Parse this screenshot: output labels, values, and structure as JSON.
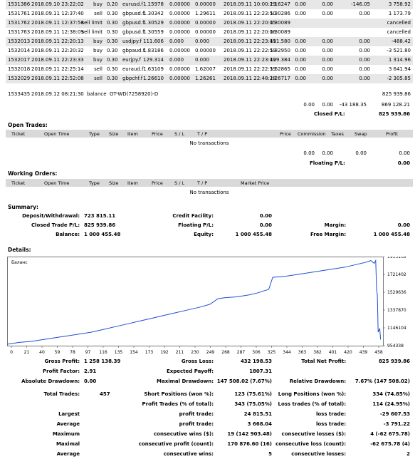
{
  "closed_trades": [
    {
      "ticket": "1531386",
      "open_time": "2018.09.10 23:22:02",
      "type": "buy",
      "size": "0.20",
      "item": "eurusd.f",
      "price": "1.15978",
      "sl": "0.00000",
      "tp": "0.00000",
      "close_time": "2018.09.11 10:00:29",
      "close_price": "1.16247",
      "commission": "0.00",
      "taxes": "0.00",
      "swap": "-146.05",
      "profit": "3 758.92"
    },
    {
      "ticket": "1531761",
      "open_time": "2018.09.11 12:37:40",
      "type": "sell",
      "size": "0.30",
      "item": "gbpusd.f",
      "price": "1.30342",
      "sl": "0.00000",
      "tp": "1.29611",
      "close_time": "2018.09.11 22:23:50",
      "close_price": "1.30286",
      "commission": "0.00",
      "taxes": "0.00",
      "swap": "0.00",
      "profit": "1 173.79"
    },
    {
      "ticket": "1531762",
      "open_time": "2018.09.11 12:37:56",
      "type": "sell limit",
      "size": "0.30",
      "item": "gbpusd.f",
      "price": "1.30529",
      "sl": "0.00000",
      "tp": "0.00000",
      "close_time": "2018.09.11 22:20:05",
      "close_price": "1.30089",
      "commission": "",
      "taxes": "",
      "swap": "",
      "profit": "cancelled"
    },
    {
      "ticket": "1531763",
      "open_time": "2018.09.11 12:38:09",
      "type": "sell limit",
      "size": "0.30",
      "item": "gbpusd.f",
      "price": "1.30559",
      "sl": "0.00000",
      "tp": "0.00000",
      "close_time": "2018.09.11 22:20:06",
      "close_price": "1.30089",
      "commission": "",
      "taxes": "",
      "swap": "",
      "profit": "cancelled"
    },
    {
      "ticket": "1532013",
      "open_time": "2018.09.11 22:20:13",
      "type": "buy",
      "size": "0.30",
      "item": "usdjpy.f",
      "price": "111.606",
      "sl": "0.000",
      "tp": "0.000",
      "close_time": "2018.09.11 22:23:49",
      "close_price": "111.580",
      "commission": "0.00",
      "taxes": "0.00",
      "swap": "0.00",
      "profit": "-488.42"
    },
    {
      "ticket": "1532014",
      "open_time": "2018.09.11 22:20:32",
      "type": "buy",
      "size": "0.30",
      "item": "gbpaud.f",
      "price": "1.83186",
      "sl": "0.00000",
      "tp": "0.00000",
      "close_time": "2018.09.11 22:22:59",
      "close_price": "1.82950",
      "commission": "0.00",
      "taxes": "0.00",
      "swap": "0.00",
      "profit": "-3 521.80"
    },
    {
      "ticket": "1532017",
      "open_time": "2018.09.11 22:23:33",
      "type": "buy",
      "size": "0.30",
      "item": "eurjpy.f",
      "price": "129.314",
      "sl": "0.000",
      "tp": "0.000",
      "close_time": "2018.09.11 22:23:49",
      "close_price": "129.384",
      "commission": "0.00",
      "taxes": "0.00",
      "swap": "0.00",
      "profit": "1 314.96"
    },
    {
      "ticket": "1532018",
      "open_time": "2018.09.11 22:25:14",
      "type": "sell",
      "size": "0.30",
      "item": "euraud.f",
      "price": "1.63109",
      "sl": "0.00000",
      "tp": "1.62007",
      "close_time": "2018.09.11 22:22:59",
      "close_price": "1.62865",
      "commission": "0.00",
      "taxes": "0.00",
      "swap": "0.00",
      "profit": "3 641.94"
    },
    {
      "ticket": "1532029",
      "open_time": "2018.09.11 22:52:08",
      "type": "sell",
      "size": "0.30",
      "item": "gbpchf.f",
      "price": "1.26610",
      "sl": "0.00000",
      "tp": "1.26261",
      "close_time": "2018.09.11 22:48:28",
      "close_price": "1.26717",
      "commission": "0.00",
      "taxes": "0.00",
      "swap": "0.00",
      "profit": "-2 305.85"
    }
  ],
  "balance_row": {
    "ticket": "1533435",
    "time": "2018.09.12 08:21:30",
    "type": "balance",
    "comment": "OT-WD(7258920)-D",
    "profit": "825 939.86"
  },
  "closed_totals": {
    "commission": "0.00",
    "taxes": "0.00",
    "swap": "-43 188.35",
    "profit": "869 128.21"
  },
  "closed_pl": {
    "label": "Closed P/L:",
    "value": "825 939.86"
  },
  "open_trades": {
    "title": "Open Trades:",
    "headers": [
      "Ticket",
      "Open Time",
      "Type",
      "Size",
      "Item",
      "Price",
      "S / L",
      "T / P",
      "Price",
      "Commission",
      "Taxes",
      "Swap",
      "Profit"
    ],
    "empty": "No transactions",
    "totals": {
      "commission": "0.00",
      "taxes": "0.00",
      "swap": "0.00",
      "profit": "0.00"
    },
    "floating_label": "Floating P/L:",
    "floating_value": "0.00"
  },
  "working_orders": {
    "title": "Working Orders:",
    "headers": [
      "Ticket",
      "Open Time",
      "Type",
      "Size",
      "Item",
      "Price",
      "S / L",
      "T / P",
      "Market Price"
    ],
    "empty": "No transactions"
  },
  "summary": {
    "title": "Summary:",
    "deposit_label": "Deposit/Withdrawal:",
    "deposit_value": "723 815.11",
    "credit_label": "Credit Facility:",
    "credit_value": "0.00",
    "closed_label": "Closed Trade P/L:",
    "closed_value": "825 939.86",
    "floating_label": "Floating P/L:",
    "floating_value": "0.00",
    "margin_label": "Margin:",
    "margin_value": "0.00",
    "balance_label": "Balance:",
    "balance_value": "1 000 455.48",
    "equity_label": "Equity:",
    "equity_value": "1 000 455.48",
    "free_margin_label": "Free Margin:",
    "free_margin_value": "1 000 455.48"
  },
  "details_title": "Details:",
  "chart_data": {
    "type": "line",
    "legend": "Баланс",
    "x_ticks": [
      "0",
      "21",
      "40",
      "59",
      "78",
      "97",
      "116",
      "135",
      "154",
      "173",
      "192",
      "211",
      "230",
      "249",
      "268",
      "287",
      "306",
      "325",
      "344",
      "363",
      "382",
      "401",
      "420",
      "439",
      "458"
    ],
    "y_ticks": [
      "1913169",
      "1721402",
      "1529636",
      "1337870",
      "1146104",
      "954338"
    ],
    "ylim": [
      954338,
      1913169
    ],
    "xlim": [
      0,
      467
    ],
    "series": [
      {
        "name": "Баланс",
        "points": [
          [
            0,
            970000
          ],
          [
            15,
            990000
          ],
          [
            30,
            1000000
          ],
          [
            45,
            1020000
          ],
          [
            60,
            1040000
          ],
          [
            75,
            1060000
          ],
          [
            90,
            1080000
          ],
          [
            105,
            1100000
          ],
          [
            120,
            1130000
          ],
          [
            135,
            1160000
          ],
          [
            150,
            1190000
          ],
          [
            165,
            1220000
          ],
          [
            180,
            1250000
          ],
          [
            195,
            1280000
          ],
          [
            210,
            1310000
          ],
          [
            225,
            1340000
          ],
          [
            240,
            1370000
          ],
          [
            252,
            1400000
          ],
          [
            262,
            1460000
          ],
          [
            270,
            1470000
          ],
          [
            285,
            1480000
          ],
          [
            300,
            1500000
          ],
          [
            310,
            1520000
          ],
          [
            325,
            1560000
          ],
          [
            330,
            1690000
          ],
          [
            345,
            1700000
          ],
          [
            360,
            1720000
          ],
          [
            375,
            1740000
          ],
          [
            390,
            1760000
          ],
          [
            405,
            1780000
          ],
          [
            420,
            1800000
          ],
          [
            435,
            1830000
          ],
          [
            445,
            1850000
          ],
          [
            452,
            1870000
          ],
          [
            456,
            1840000
          ],
          [
            458,
            1870000
          ],
          [
            459,
            1560000
          ],
          [
            460,
            1500000
          ],
          [
            461,
            1100000
          ],
          [
            463,
            1140000
          ],
          [
            464,
            1020000
          ]
        ]
      }
    ]
  },
  "stats": {
    "gross_profit_label": "Gross Profit:",
    "gross_profit": "1 258 138.39",
    "gross_loss_label": "Gross Loss:",
    "gross_loss": "432 198.53",
    "total_net_label": "Total Net Profit:",
    "total_net": "825 939.86",
    "profit_factor_label": "Profit Factor:",
    "profit_factor": "2.91",
    "expected_payoff_label": "Expected Payoff:",
    "expected_payoff": "1807.31",
    "abs_dd_label": "Absolute Drawdown:",
    "abs_dd": "0.00",
    "max_dd_label": "Maximal Drawdown:",
    "max_dd": "147 508.02 (7.67%)",
    "rel_dd_label": "Relative Drawdown:",
    "rel_dd": "7.67% (147 508.02)",
    "total_trades_label": "Total Trades:",
    "total_trades": "457",
    "short_label": "Short Positions (won %):",
    "short": "123 (75.61%)",
    "long_label": "Long Positions (won %):",
    "long": "334 (74.85%)",
    "profit_trades_label": "Profit Trades (% of total):",
    "profit_trades": "343 (75.05%)",
    "loss_trades_label": "Loss trades (% of total):",
    "loss_trades": "114 (24.95%)",
    "largest_label": "Largest",
    "largest_profit_label": "profit trade:",
    "largest_profit": "24 815.51",
    "largest_loss_label": "loss trade:",
    "largest_loss": "-29 607.53",
    "average_label": "Average",
    "avg_profit_label": "profit trade:",
    "avg_profit": "3 668.04",
    "avg_loss_label": "loss trade:",
    "avg_loss": "-3 791.22",
    "maximum_label": "Maximum",
    "max_wins_label": "consecutive wins ($):",
    "max_wins": "19 (142 903.48)",
    "max_losses_label": "consecutive losses ($):",
    "max_losses": "4 (-62 675.78)",
    "maximal_label": "Maximal",
    "maximal_profit_label": "consecutive profit (count):",
    "maximal_profit": "170 876.60 (16)",
    "maximal_loss_label": "consecutive loss (count):",
    "maximal_loss": "-62 675.78 (4)",
    "average2_label": "Average",
    "avg_wins_label": "consecutive wins:",
    "avg_wins": "5",
    "avg_losses_label": "consecutive losses:",
    "avg_losses": "2"
  }
}
